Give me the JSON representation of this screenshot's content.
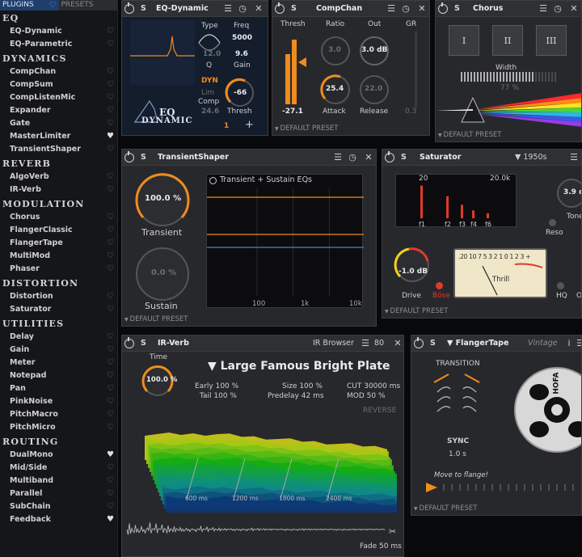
{
  "sidebar": {
    "tabs": {
      "plugins": "PLUGINS",
      "presets": "PRESETS"
    },
    "categories": [
      {
        "name": "EQ",
        "items": [
          "EQ-Dynamic",
          "EQ-Parametric"
        ]
      },
      {
        "name": "DYNAMICS",
        "items": [
          "CompChan",
          "CompSum",
          "CompListenMic",
          "Expander",
          "Gate",
          "MasterLimiter",
          "TransientShaper"
        ]
      },
      {
        "name": "REVERB",
        "items": [
          "AlgoVerb",
          "IR-Verb"
        ]
      },
      {
        "name": "MODULATION",
        "items": [
          "Chorus",
          "FlangerClassic",
          "FlangerTape",
          "MultiMod",
          "Phaser"
        ]
      },
      {
        "name": "DISTORTION",
        "items": [
          "Distortion",
          "Saturator"
        ]
      },
      {
        "name": "UTILITIES",
        "items": [
          "Delay",
          "Gain",
          "Meter",
          "Notepad",
          "Pan",
          "PinkNoise",
          "PitchMacro",
          "PitchMicro"
        ]
      },
      {
        "name": "ROUTING",
        "items": [
          "DualMono",
          "Mid/Side",
          "Multiband",
          "Parallel",
          "SubChain",
          "Feedback"
        ]
      }
    ],
    "filled_favorites": [
      "MasterLimiter",
      "DualMono",
      "Feedback"
    ]
  },
  "common": {
    "s_label": "S",
    "default_preset": "DEFAULT PRESET"
  },
  "eq_dynamic": {
    "title": "EQ-Dynamic",
    "type_label": "Type",
    "freq_label": "Freq",
    "freq_value": "5000",
    "q_value": "12.0",
    "gain_value": "9.6",
    "q_label": "Q",
    "gain_label": "Gain",
    "dyn_label": "DYN",
    "lim_label": "Lim",
    "comp_label": "Comp",
    "comp_value": "24.6",
    "thresh_value": "-66",
    "thresh_label": "Thresh",
    "band_number": "1",
    "add_symbol": "+",
    "logo_top": "EQ",
    "logo_bottom": "DYNAMIC"
  },
  "compchan": {
    "title": "CompChan",
    "thresh_label": "Thresh",
    "ratio_label": "Ratio",
    "out_label": "Out",
    "gr_label": "GR",
    "thresh_value": "-27.1",
    "ratio_value": "3.0",
    "out_value": "3.0 dB",
    "attack_value": "25.4",
    "attack_label": "Attack",
    "release_value": "22.0",
    "release_label": "Release",
    "gr_value": "0.3"
  },
  "chorus": {
    "title": "Chorus",
    "voices": [
      "I",
      "II",
      "III"
    ],
    "width_label": "Width",
    "width_value": "77 %"
  },
  "transient": {
    "title": "TransientShaper",
    "transient_value": "100.0 %",
    "transient_label": "Transient",
    "sustain_value": "0.0 %",
    "sustain_label": "Sustain",
    "graph_title": "Transient + Sustain EQs",
    "freq_ticks": [
      "100",
      "1k",
      "10k"
    ]
  },
  "saturator": {
    "title": "Saturator",
    "preset": "1950s",
    "freq_low": "20",
    "freq_high": "20.0k",
    "harmonics": [
      "f1",
      "f2",
      "f3",
      "f4",
      "f6"
    ],
    "harmonic_levels": [
      0.92,
      0.62,
      0.38,
      0.22,
      0.14
    ],
    "tone_value": "3.9 d",
    "tone_label": "Tone",
    "reso_label": "Reso",
    "drive_value": "-1.0 dB",
    "drive_label": "Drive",
    "bose_label": "Böse",
    "meter_scale": ".20  10  7  5  3 2 1 0 1 2 3 +",
    "thrill_label": "Thrill",
    "hq_label": "HQ",
    "o_label": "O"
  },
  "irverb": {
    "title": "IR-Verb",
    "browser_label": "IR Browser",
    "browser_number": "80",
    "preset_name": "Large Famous Bright Plate",
    "time_label": "Time",
    "time_value": "100.0 %",
    "early": "Early 100 %",
    "tail": "Tail 100 %",
    "size": "Size  100 %",
    "predelay": "Predelay  42 ms",
    "cut": "CUT 30000 ms",
    "mod": "MOD       50 %",
    "reverse_label": "REVERSE",
    "time_ticks": [
      "600 ms",
      "1200 ms",
      "1800 ms",
      "2400 ms"
    ],
    "fade_label": "Fade",
    "fade_value": "50 ms"
  },
  "flanger": {
    "title": "FlangerTape",
    "preset": "Vintage",
    "transition_label": "TRANSITION",
    "sync_label": "SYNC",
    "sync_value": "1.0 s",
    "move_label": "Move to flange!",
    "reel_brand": "HOFA"
  },
  "colors": {
    "accent": "#f08c1e",
    "selected_panel": "#141d2c",
    "tab_active": "#1f3e6c",
    "spectrum_line": "#f08c1e"
  }
}
